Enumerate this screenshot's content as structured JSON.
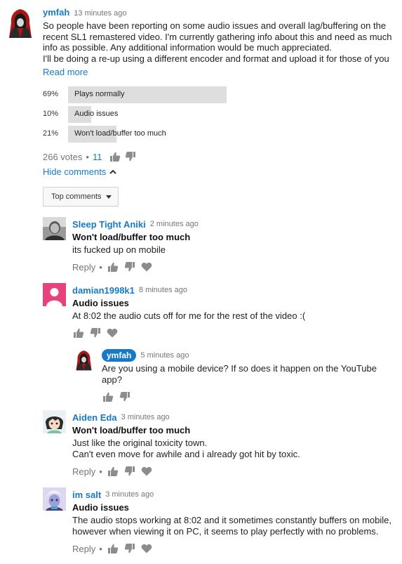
{
  "post": {
    "author": "ymfah",
    "time": "13 minutes ago",
    "lines": [
      "So people have been reporting on some audio issues and overall lag/buffering on the",
      "recent SL1 remastered video. I'm currently gathering info about this and need as much",
      "info as possible. Any additional information would be much appreciated.",
      "I'll be doing a re-up using a different encoder and format and upload it for those of you"
    ],
    "read_more": "Read more"
  },
  "poll": {
    "options": [
      {
        "pct_text": "69%",
        "fraction": 0.69,
        "label": "Plays normally"
      },
      {
        "pct_text": "10%",
        "fraction": 0.1,
        "label": "Audio issues"
      },
      {
        "pct_text": "21%",
        "fraction": 0.21,
        "label": "Won't load/buffer too much"
      }
    ],
    "votes": "266 votes",
    "separator": "•",
    "likes": "11"
  },
  "hide_comments": "Hide comments",
  "sort_label": "Top comments",
  "comments": [
    {
      "author": "Sleep Tight Aniki",
      "time": "2 minutes ago",
      "vote": "Won't load/buffer too much",
      "lines": [
        "its fucked up on mobile"
      ],
      "reply": "Reply",
      "separator": "•"
    },
    {
      "author": "damian1998k1",
      "time": "8 minutes ago",
      "vote": "Audio issues",
      "lines": [
        "At 8:02 the audio cuts off for me for the rest of the video :("
      ]
    },
    {
      "author": "Aiden Eda",
      "time": "3 minutes ago",
      "vote": "Won't load/buffer too much",
      "lines": [
        "Just like the original toxicity town.",
        "Can't even move for awhile and i already got hit by toxic."
      ],
      "reply": "Reply",
      "separator": "•"
    },
    {
      "author": "im salt",
      "time": "3 minutes ago",
      "vote": "Audio issues",
      "lines": [
        "The audio stops working at 8:02 and it sometimes constantly buffers on mobile,",
        "however when viewing it on PC, it seems to play perfectly with no problems."
      ],
      "reply": "Reply",
      "separator": "•"
    }
  ],
  "owner_reply": {
    "author": "ymfah",
    "time": "5 minutes ago",
    "lines": [
      "Are you using a mobile device? If so does it happen on the YouTube",
      "app?"
    ]
  },
  "colors": {
    "link": "#167ac6",
    "poll_fill": "#dedede",
    "avatar_pink": "#e8427c"
  }
}
